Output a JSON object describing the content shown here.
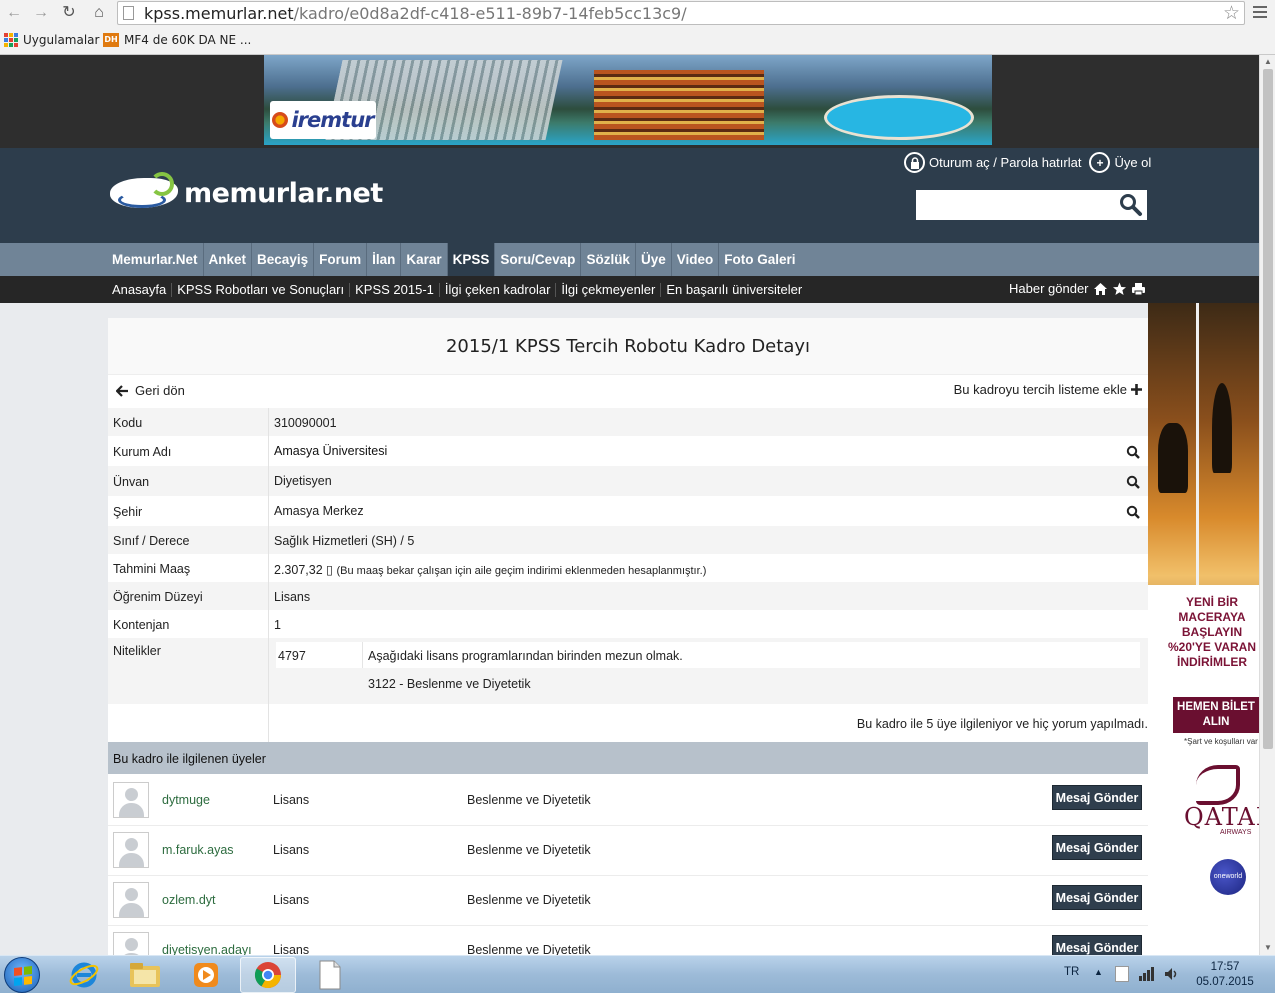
{
  "browser": {
    "url_host": "kpss.memurlar.net",
    "url_path": "/kadro/e0d8a2df-c418-e511-89b7-14feb5cc13c9/",
    "bookmarks": [
      "Uygulamalar",
      "MF4 de 60K DA NE ..."
    ],
    "bookmark_icons": [
      "apps-grid-icon",
      "dh-icon"
    ],
    "dh_badge": "DH"
  },
  "ad_top": {
    "brand": "iremtur"
  },
  "header": {
    "logo_text": "memurlar.net",
    "login_text": "Oturum aç / Parola hatırlat",
    "register_text": "Üye ol",
    "search_placeholder": ""
  },
  "main_nav": {
    "items": [
      "Memurlar.Net",
      "Anket",
      "Becayiş",
      "Forum",
      "İlan",
      "Karar",
      "KPSS",
      "Soru/Cevap",
      "Sözlük",
      "Üye",
      "Video",
      "Foto Galeri"
    ],
    "active": "KPSS"
  },
  "sub_nav": {
    "items": [
      "Anasayfa",
      "KPSS Robotları ve Sonuçları",
      "KPSS 2015-1",
      "İlgi çeken kadrolar",
      "İlgi çekmeyenler",
      "En başarılı üniversiteler"
    ],
    "send_news": "Haber gönder"
  },
  "detail": {
    "title": "2015/1 KPSS Tercih Robotu Kadro Detayı",
    "back": "Geri dön",
    "add_to_list": "Bu kadroyu tercih listeme ekle",
    "rows": [
      {
        "label": "Kodu",
        "value": "310090001"
      },
      {
        "label": "Kurum Adı",
        "value": "Amasya Üniversitesi"
      },
      {
        "label": "Ünvan",
        "value": "Diyetisyen"
      },
      {
        "label": "Şehir",
        "value": "Amasya Merkez"
      },
      {
        "label": "Sınıf / Derece",
        "value": "Sağlık Hizmetleri (SH) / 5"
      },
      {
        "label": "Tahmini Maaş",
        "value": "2.307,32 ▯",
        "note": "(Bu maaş bekar çalışan için aile geçim indirimi eklenmeden hesaplanmıştır.)"
      },
      {
        "label": "Öğrenim Düzeyi",
        "value": "Lisans"
      },
      {
        "label": "Kontenjan",
        "value": "1"
      }
    ],
    "qualifications_label": "Nitelikler",
    "qualifications": [
      {
        "code": "4797",
        "text": "Aşağıdaki lisans programlarından birinden mezun olmak."
      },
      {
        "code": "",
        "text": "3122 - Beslenme ve Diyetetik"
      }
    ],
    "stats": "Bu kadro ile 5 üye ilgileniyor ve hiç yorum yapılmadı."
  },
  "members": {
    "header": "Bu kadro ile ilgilenen üyeler",
    "button_label": "Mesaj Gönder",
    "list": [
      {
        "username": "dytmuge",
        "education": "Lisans",
        "program": "Beslenme ve Diyetetik"
      },
      {
        "username": "m.faruk.ayas",
        "education": "Lisans",
        "program": "Beslenme ve Diyetetik"
      },
      {
        "username": "ozlem.dyt",
        "education": "Lisans",
        "program": "Beslenme ve Diyetetik"
      },
      {
        "username": "diyetisyen.adayı",
        "education": "Lisans",
        "program": "Beslenme ve Diyetetik"
      }
    ]
  },
  "ad_side": {
    "headline": "YENİ BİR MACERAYA BAŞLAYIN %20'YE VARAN İNDİRİMLER",
    "cta": "HEMEN BİLET ALIN",
    "small": "*Şart ve koşulları var",
    "brand": "QATAR",
    "sub": "AIRWAYS",
    "alliance": "oneworld"
  },
  "taskbar": {
    "lang": "TR",
    "time": "17:57",
    "date": "05.07.2015"
  },
  "colors": {
    "header_bg": "#2d3d4c",
    "nav_bg": "#708497",
    "subnav_bg": "#262626",
    "member_header_bg": "#b7c1cb",
    "button_bg": "#2f3e4d",
    "username_color": "#2d6c3f"
  }
}
